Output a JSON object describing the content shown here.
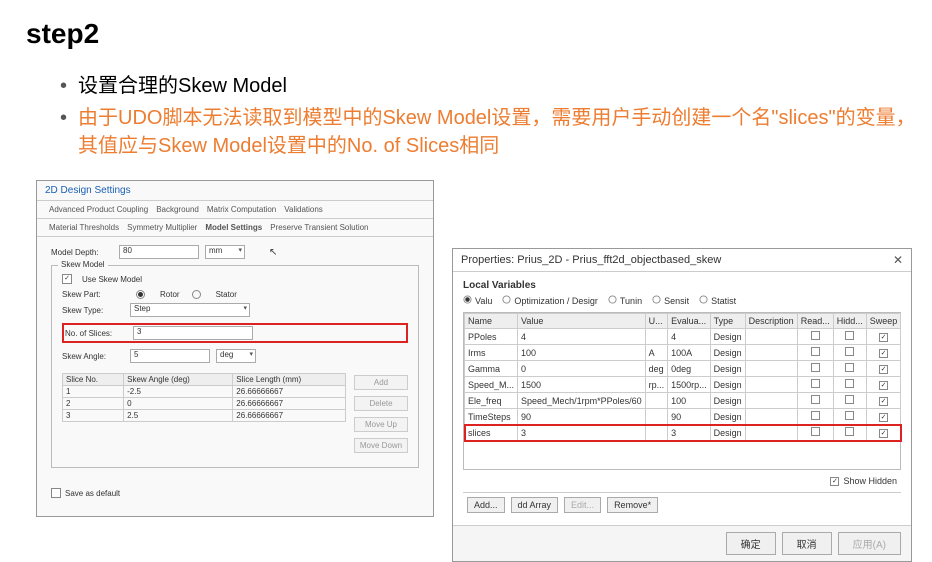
{
  "title": "step2",
  "bullets": {
    "b1": "设置合理的Skew Model",
    "b2": "由于UDO脚本无法读取到模型中的Skew Model设置，需要用户手动创建一个名\"slices\"的变量，其值应与Skew Model设置中的No. of Slices相同"
  },
  "leftDialog": {
    "title": "2D Design Settings",
    "tabs": {
      "r1a": "Advanced Product Coupling",
      "r1b": "Background",
      "r1c": "Matrix Computation",
      "r1d": "Validations",
      "r2a": "Material Thresholds",
      "r2b": "Symmetry Multiplier",
      "r2c": "Model Settings",
      "r2d": "Preserve Transient Solution"
    },
    "modelDepth": {
      "label": "Model Depth:",
      "value": "80",
      "unit": "mm"
    },
    "skewGroup": {
      "title": "Skew Model",
      "useSkew": "Use Skew Model",
      "skewPartLabel": "Skew Part:",
      "rotor": "Rotor",
      "stator": "Stator",
      "skewTypeLabel": "Skew Type:",
      "skewTypeValue": "Step",
      "noSlicesLabel": "No. of Slices:",
      "noSlicesValue": "3",
      "skewAngleLabel": "Skew Angle:",
      "skewAngleValue": "5",
      "skewAngleUnit": "deg"
    },
    "sliceTable": {
      "h1": "Slice No.",
      "h2": "Skew Angle (deg)",
      "h3": "Slice Length (mm)",
      "rows": [
        {
          "no": "1",
          "ang": "-2.5",
          "len": "26.66666667"
        },
        {
          "no": "2",
          "ang": "0",
          "len": "26.66666667"
        },
        {
          "no": "3",
          "ang": "2.5",
          "len": "26.66666667"
        }
      ]
    },
    "sideButtons": {
      "add": "Add",
      "delete": "Delete",
      "moveUp": "Move Up",
      "moveDown": "Move Down"
    },
    "saveDefault": "Save as default"
  },
  "rightDialog": {
    "title": "Properties: Prius_2D - Prius_fft2d_objectbased_skew",
    "localVars": "Local Variables",
    "radios": {
      "value": "Valu",
      "opt": "Optimization / Desigr",
      "tuning": "Tunin",
      "sensit": "Sensit",
      "stat": "Statist"
    },
    "headers": {
      "name": "Name",
      "value": "Value",
      "unit": "U...",
      "eval": "Evalua...",
      "type": "Type",
      "desc": "Description",
      "read": "Read...",
      "hid": "Hidd...",
      "sweep": "Sweep"
    },
    "rows": [
      {
        "name": "PPoles",
        "value": "4",
        "unit": "",
        "eval": "4",
        "type": "Design"
      },
      {
        "name": "Irms",
        "value": "100",
        "unit": "A",
        "eval": "100A",
        "type": "Design"
      },
      {
        "name": "Gamma",
        "value": "0",
        "unit": "deg",
        "eval": "0deg",
        "type": "Design"
      },
      {
        "name": "Speed_M...",
        "value": "1500",
        "unit": "rp...",
        "eval": "1500rp...",
        "type": "Design"
      },
      {
        "name": "Ele_freq",
        "value": "Speed_Mech/1rpm*PPoles/60",
        "unit": "",
        "eval": "100",
        "type": "Design"
      },
      {
        "name": "TimeSteps",
        "value": "90",
        "unit": "",
        "eval": "90",
        "type": "Design"
      },
      {
        "name": "slices",
        "value": "3",
        "unit": "",
        "eval": "3",
        "type": "Design",
        "hl": true
      }
    ],
    "showHidden": "Show Hidden",
    "bottomButtons": {
      "add": "Add...",
      "addArray": "dd Array",
      "edit": "Edit...",
      "remove": "Remove*"
    },
    "footer": {
      "ok": "确定",
      "cancel": "取消",
      "apply": "应用(A)"
    }
  }
}
